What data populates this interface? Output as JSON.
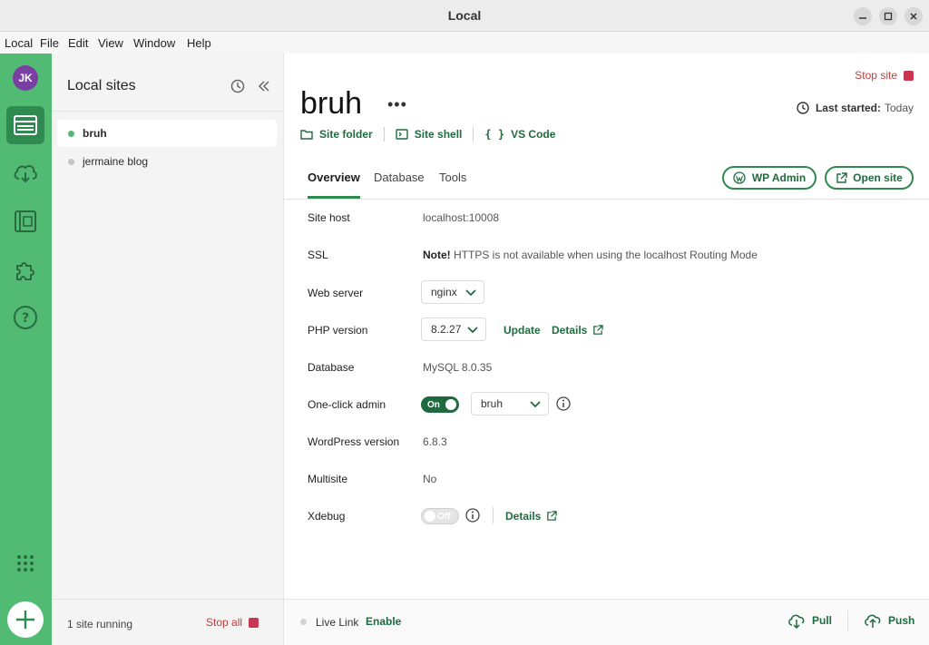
{
  "window": {
    "title": "Local"
  },
  "menu": [
    "Local",
    "File",
    "Edit",
    "View",
    "Window",
    "Help"
  ],
  "user": {
    "initials": "JK"
  },
  "sidebar_icons": [
    "sites-icon",
    "cloud-icon",
    "blueprints-icon",
    "addons-icon",
    "help-icon",
    "apps-grid-icon",
    "add-icon"
  ],
  "sites_panel": {
    "title": "Local sites",
    "sites": [
      {
        "name": "bruh",
        "status": "running"
      },
      {
        "name": "jermaine blog",
        "status": "stopped"
      }
    ],
    "footer": {
      "running": "1 site running",
      "stop_all": "Stop all"
    }
  },
  "site": {
    "name": "bruh",
    "stop_site": "Stop site",
    "last_started_label": "Last started:",
    "last_started_value": "Today",
    "links": {
      "folder": "Site folder",
      "shell": "Site shell",
      "vscode": "VS Code"
    }
  },
  "tabs": [
    "Overview",
    "Database",
    "Tools"
  ],
  "actions": {
    "wp_admin": "WP Admin",
    "open_site": "Open site"
  },
  "overview": {
    "site_host": {
      "label": "Site host",
      "value": "localhost:10008"
    },
    "ssl": {
      "label": "SSL",
      "note_bold": "Note!",
      "note": "HTTPS is not available when using the localhost Routing Mode"
    },
    "web_server": {
      "label": "Web server",
      "value": "nginx"
    },
    "php": {
      "label": "PHP version",
      "value": "8.2.27",
      "update": "Update",
      "details": "Details"
    },
    "database": {
      "label": "Database",
      "value": "MySQL 8.0.35"
    },
    "one_click": {
      "label": "One-click admin",
      "toggle": "On",
      "user": "bruh"
    },
    "wp_version": {
      "label": "WordPress version",
      "value": "6.8.3"
    },
    "multisite": {
      "label": "Multisite",
      "value": "No"
    },
    "xdebug": {
      "label": "Xdebug",
      "toggle": "Off",
      "details": "Details"
    }
  },
  "footer": {
    "live_link": "Live Link",
    "enable": "Enable",
    "pull": "Pull",
    "push": "Push"
  },
  "colors": {
    "brand_green": "#51bb73",
    "dark_green": "#2f8a4f",
    "stop_red": "#c8364f"
  }
}
